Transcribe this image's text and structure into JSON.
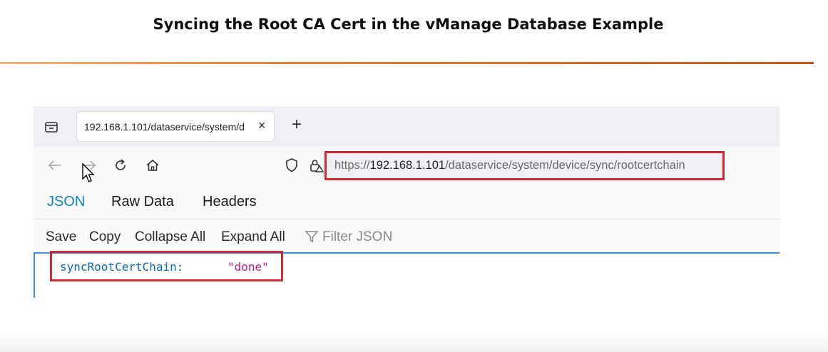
{
  "slide": {
    "title": "Syncing the Root CA Cert in the vManage Database Example"
  },
  "browser": {
    "tab": {
      "title": "192.168.1.101/dataservice/system/d",
      "close_glyph": "×"
    },
    "new_tab_glyph": "+",
    "url": {
      "scheme": "https://",
      "host": "192.168.1.101",
      "path": "/dataservice/system/device/sync/rootcertchain"
    }
  },
  "viewer": {
    "tabs": [
      {
        "label": "JSON",
        "active": true
      },
      {
        "label": "Raw Data",
        "active": false
      },
      {
        "label": "Headers",
        "active": false
      }
    ],
    "toolbar": {
      "save": "Save",
      "copy": "Copy",
      "collapse_all": "Collapse All",
      "expand_all": "Expand All",
      "filter_placeholder": "Filter JSON"
    },
    "rows": [
      {
        "key": "syncRootCertChain:",
        "value": "\"done\""
      }
    ]
  },
  "colors": {
    "highlight": "#d12a36",
    "json_key": "#0b6ab4",
    "json_string": "#c3198a",
    "active_tab": "#0a84c2",
    "rule_accent": "#e8802f"
  }
}
